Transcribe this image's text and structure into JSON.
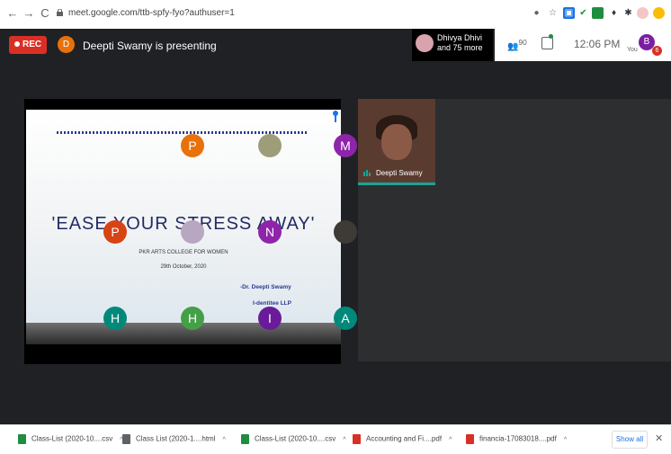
{
  "browser": {
    "url": "meet.google.com/ttb-spfy-fyo?authuser=1",
    "back_glyph": "←",
    "forward_glyph": "→",
    "reload_glyph": "C"
  },
  "meeting": {
    "rec_label": "REC",
    "presenter_initial": "D",
    "presenting_text": "Deepti Swamy is presenting",
    "participants_name": "Dhivya Dhivi",
    "participants_more": "and 75 more",
    "people_count": "90",
    "time": "12:06 PM",
    "you_label": "You",
    "you_initial": "B",
    "you_badge": "6"
  },
  "slide": {
    "title": "'EASE YOUR STRESS AWAY'",
    "college": "PKR ARTS COLLEGE FOR WOMEN",
    "date": "29th October, 2020",
    "author": "-Dr. Deepti Swamy",
    "org": "I-dentitee LLP"
  },
  "grid": {
    "camera_name": "Deepti Swamy",
    "tiles": [
      {
        "initial": "P",
        "color": "#e8710a"
      },
      {
        "initial": "",
        "color": "#9e9d7a"
      },
      {
        "initial": "M",
        "color": "#8e24aa"
      },
      {
        "initial": "P",
        "color": "#d84315"
      },
      {
        "initial": "",
        "color": "#b7a7c0"
      },
      {
        "initial": "N",
        "color": "#8e24aa"
      },
      {
        "initial": "",
        "color": "#3e3a36"
      },
      {
        "initial": "H",
        "color": "#00897b"
      },
      {
        "initial": "H",
        "color": "#43a047"
      },
      {
        "initial": "I",
        "color": "#6a1b9a"
      },
      {
        "initial": "A",
        "color": "#00897b"
      }
    ]
  },
  "downloads": {
    "items": [
      {
        "label": "Class-List (2020-10....csv",
        "color": "#1e8e3e"
      },
      {
        "label": "Class List (2020-1....html",
        "color": "#5f6368"
      },
      {
        "label": "Class-List (2020-10....csv",
        "color": "#1e8e3e"
      },
      {
        "label": "Accounting and Fi....pdf",
        "color": "#d93025"
      },
      {
        "label": "financia-17083018....pdf",
        "color": "#d93025"
      }
    ],
    "show_all": "Show all",
    "close_glyph": "✕"
  },
  "colors": {
    "meet_bg": "#202124",
    "rec_red": "#d93025",
    "accent_teal": "#1aa39a",
    "slide_title": "#232b66"
  }
}
